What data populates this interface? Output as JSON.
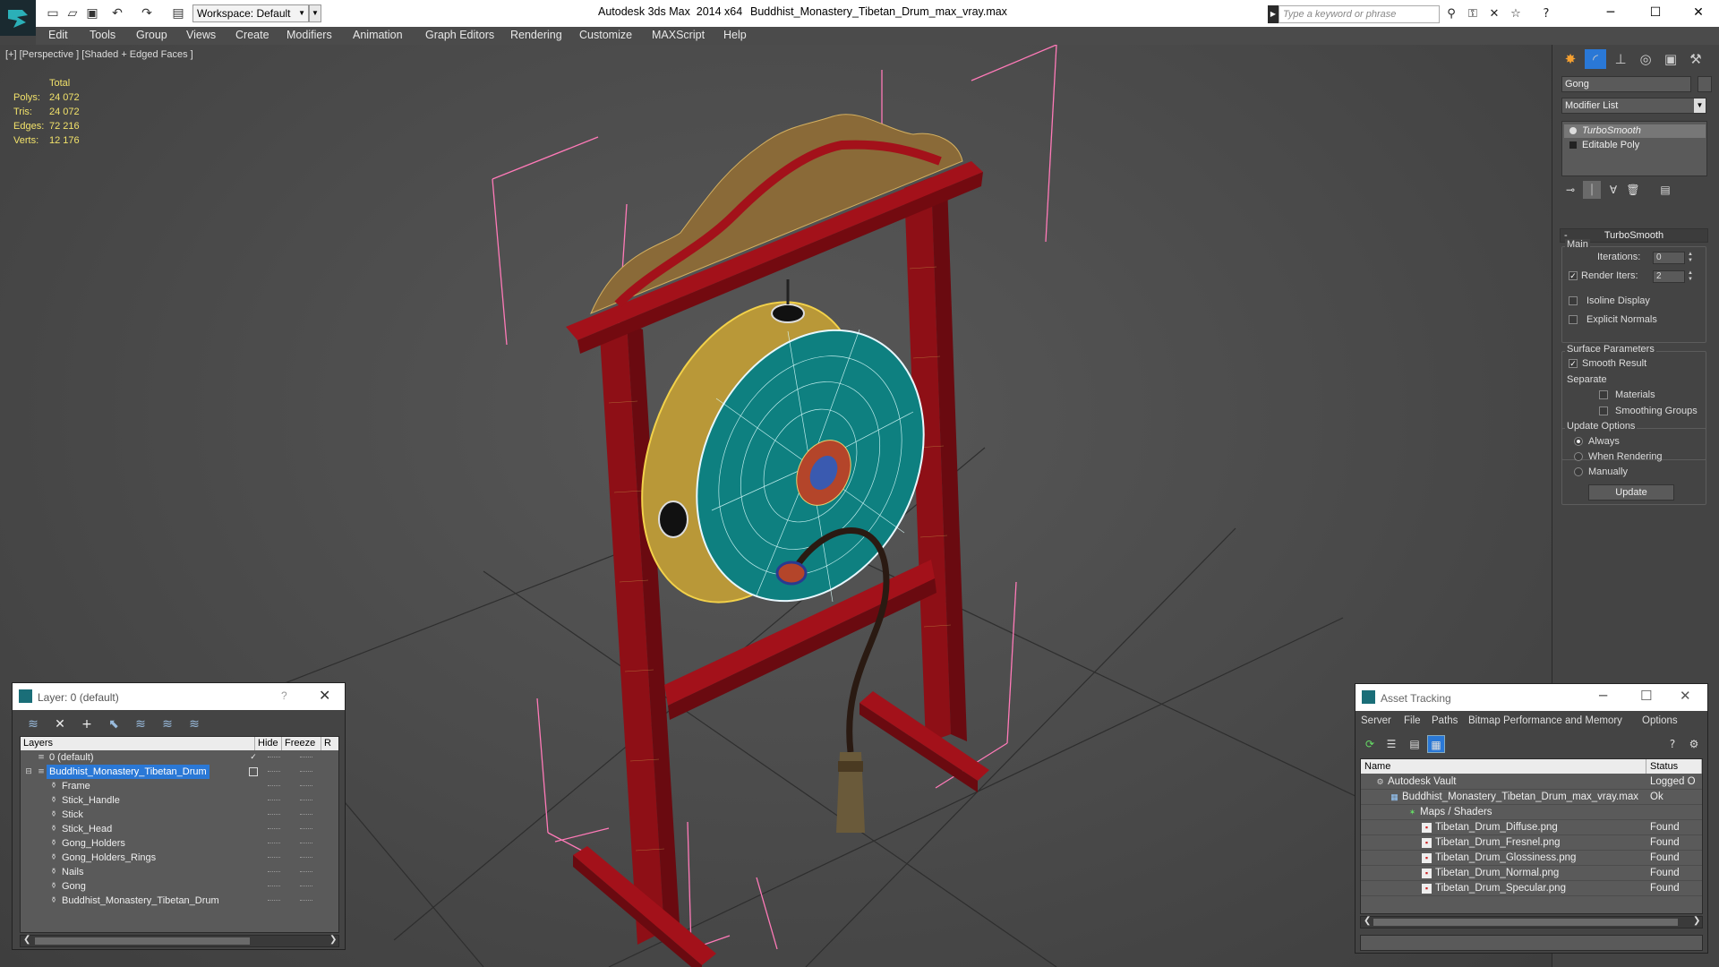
{
  "titlebar": {
    "workspace_label": "Workspace: Default",
    "app_title": "Autodesk 3ds Max  2014 x64",
    "file_title": "Buddhist_Monastery_Tibetan_Drum_max_vray.max",
    "search_placeholder": "Type a keyword or phrase"
  },
  "menu": [
    "Edit",
    "Tools",
    "Group",
    "Views",
    "Create",
    "Modifiers",
    "Animation",
    "Graph Editors",
    "Rendering",
    "Customize",
    "MAXScript",
    "Help"
  ],
  "viewport": {
    "label": "[+] [Perspective ] [Shaded + Edged Faces ]",
    "stats": {
      "header": "Total",
      "rows": [
        {
          "label": "Polys:",
          "value": "24 072"
        },
        {
          "label": "Tris:",
          "value": "24 072"
        },
        {
          "label": "Edges:",
          "value": "72 216"
        },
        {
          "label": "Verts:",
          "value": "12 176"
        }
      ]
    }
  },
  "command_panel": {
    "object_name": "Gong",
    "modifier_list": "Modifier List",
    "stack": [
      "TurboSmooth",
      "Editable Poly"
    ],
    "rollout_title": "TurboSmooth",
    "main_group": "Main",
    "iterations_label": "Iterations:",
    "iterations_value": "0",
    "render_iters_label": "Render Iters:",
    "render_iters_value": "2",
    "render_iters_checked": true,
    "isoline_label": "Isoline Display",
    "explicit_normals_label": "Explicit Normals",
    "surface_group": "Surface Parameters",
    "smooth_result_label": "Smooth Result",
    "separate_label": "Separate",
    "materials_label": "Materials",
    "smoothing_groups_label": "Smoothing Groups",
    "update_group": "Update Options",
    "radio_always": "Always",
    "radio_when_rendering": "When Rendering",
    "radio_manually": "Manually",
    "update_button": "Update"
  },
  "layer_dialog": {
    "title": "Layer: 0 (default)",
    "help": "?",
    "col_layers": "Layers",
    "col_hide": "Hide",
    "col_freeze": "Freeze",
    "col_r": "R",
    "rows": [
      {
        "name": "0 (default)",
        "type": "layer"
      },
      {
        "name": "Buddhist_Monastery_Tibetan_Drum",
        "type": "layer-selected"
      },
      {
        "name": "Frame",
        "type": "object"
      },
      {
        "name": "Stick_Handle",
        "type": "object"
      },
      {
        "name": "Stick",
        "type": "object"
      },
      {
        "name": "Stick_Head",
        "type": "object"
      },
      {
        "name": "Gong_Holders",
        "type": "object"
      },
      {
        "name": "Gong_Holders_Rings",
        "type": "object"
      },
      {
        "name": "Nails",
        "type": "object"
      },
      {
        "name": "Gong",
        "type": "object"
      },
      {
        "name": "Buddhist_Monastery_Tibetan_Drum",
        "type": "object"
      }
    ]
  },
  "asset_dialog": {
    "title": "Asset Tracking",
    "menu": [
      "Server",
      "File",
      "Paths",
      "Bitmap Performance and Memory",
      "Options"
    ],
    "col_name": "Name",
    "col_status": "Status",
    "rows": [
      {
        "name": "Autodesk Vault",
        "status": "Logged O",
        "level": 0
      },
      {
        "name": "Buddhist_Monastery_Tibetan_Drum_max_vray.max",
        "status": "Ok",
        "level": 1
      },
      {
        "name": "Maps / Shaders",
        "status": "",
        "level": 2
      },
      {
        "name": "Tibetan_Drum_Diffuse.png",
        "status": "Found",
        "level": 3
      },
      {
        "name": "Tibetan_Drum_Fresnel.png",
        "status": "Found",
        "level": 3
      },
      {
        "name": "Tibetan_Drum_Glossiness.png",
        "status": "Found",
        "level": 3
      },
      {
        "name": "Tibetan_Drum_Normal.png",
        "status": "Found",
        "level": 3
      },
      {
        "name": "Tibetan_Drum_Specular.png",
        "status": "Found",
        "level": 3
      }
    ]
  },
  "colors": {
    "viewport_bg": "#4a4a4a",
    "stats_text": "#f2e26a",
    "selection": "#2a78d6",
    "frame_red": "#a3111a",
    "wire_yellow": "#e8c43a",
    "drum_teal": "#0e8080",
    "bbox_pink": "#ff7ab8"
  }
}
